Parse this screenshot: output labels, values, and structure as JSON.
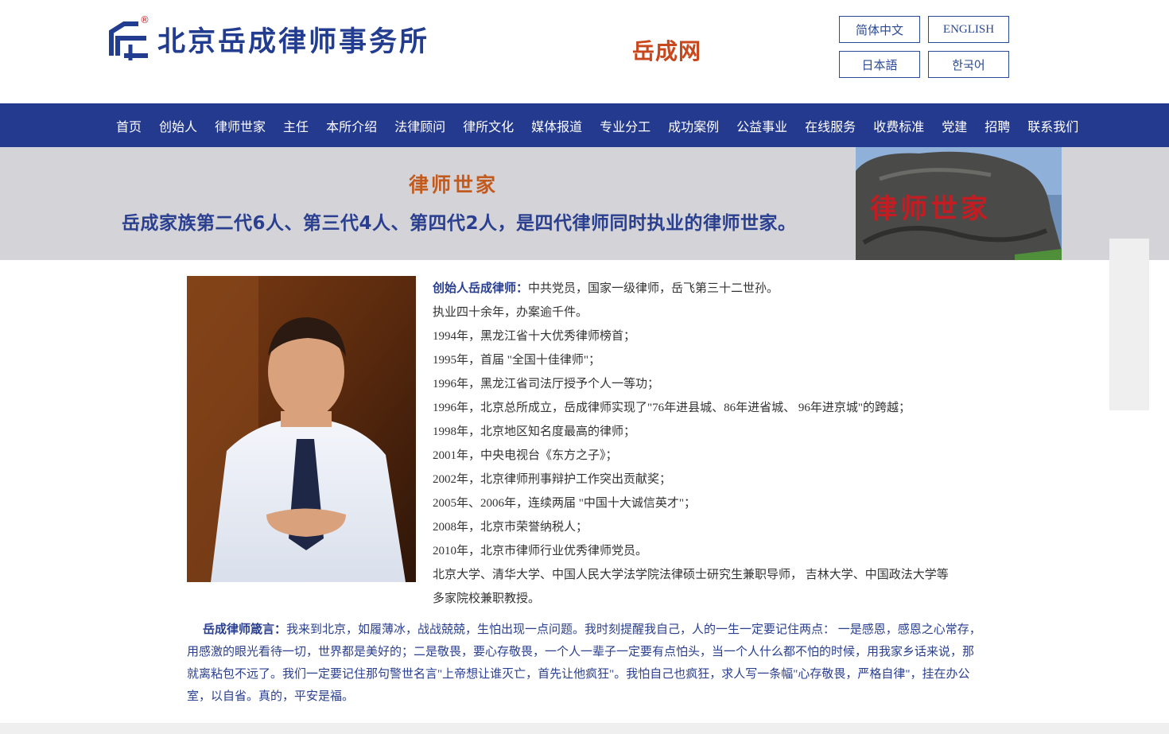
{
  "header": {
    "logo_text": "北京岳成律师事务所",
    "logo_reg": "®",
    "sub_logo": "岳成网",
    "languages": [
      "简体中文",
      "ENGLISH",
      "日本語",
      "한국어"
    ]
  },
  "nav": {
    "items": [
      "首页",
      "创始人",
      "律师世家",
      "主任",
      "本所介绍",
      "法律顾问",
      "律所文化",
      "媒体报道",
      "专业分工",
      "成功案例",
      "公益事业",
      "在线服务",
      "收费标准",
      "党建",
      "招聘",
      "联系我们"
    ]
  },
  "banner": {
    "title": "律师世家",
    "subtitle": "岳成家族第二代6人、第三代4人、第四代2人，是四代律师同时执业的律师世家。",
    "stone_text": "律师世家"
  },
  "bio": {
    "head_label": "创始人岳成律师：",
    "head_text": "中共党员，国家一级律师，岳飞第三十二世孙。",
    "lines": [
      "执业四十余年，办案逾千件。",
      "1994年，黑龙江省十大优秀律师榜首；",
      "1995年，首届 \"全国十佳律师\"；",
      "1996年，黑龙江省司法厅授予个人一等功；",
      "1996年，北京总所成立，岳成律师实现了\"76年进县城、86年进省城、 96年进京城\"的跨越；",
      "1998年，北京地区知名度最高的律师；",
      "2001年，中央电视台《东方之子》；",
      "2002年，北京律师刑事辩护工作突出贡献奖；",
      "2005年、2006年，连续两届 \"中国十大诚信英才\"；",
      "2008年，北京市荣誉纳税人；",
      "2010年，北京市律师行业优秀律师党员。",
      "北京大学、清华大学、中国人民大学法学院法律硕士研究生兼职导师， 吉林大学、中国政法大学等",
      "多家院校兼职教授。"
    ]
  },
  "motto": {
    "head_label": "岳成律师箴言：",
    "text": "我来到北京，如履薄冰，战战兢兢，生怕出现一点问题。我时刻提醒我自己，人的一生一定要记住两点： 一是感恩，感恩之心常存，用感激的眼光看待一切，世界都是美好的；二是敬畏，要心存敬畏，一个人一辈子一定要有点怕头，当一个人什么都不怕的时候，用我家乡话来说，那就离粘包不远了。我们一定要记住那句警世名言\"上帝想让谁灭亡，首先让他疯狂\"。我怕自己也疯狂，求人写一条幅\"心存敬畏，严格自律\"，挂在办公室，以自省。真的，平安是福。"
  },
  "colors": {
    "nav_bg": "#243a8e",
    "brand_blue": "#2a3f8f",
    "accent_orange": "#c8471d",
    "banner_bg": "#d4d4d8"
  }
}
